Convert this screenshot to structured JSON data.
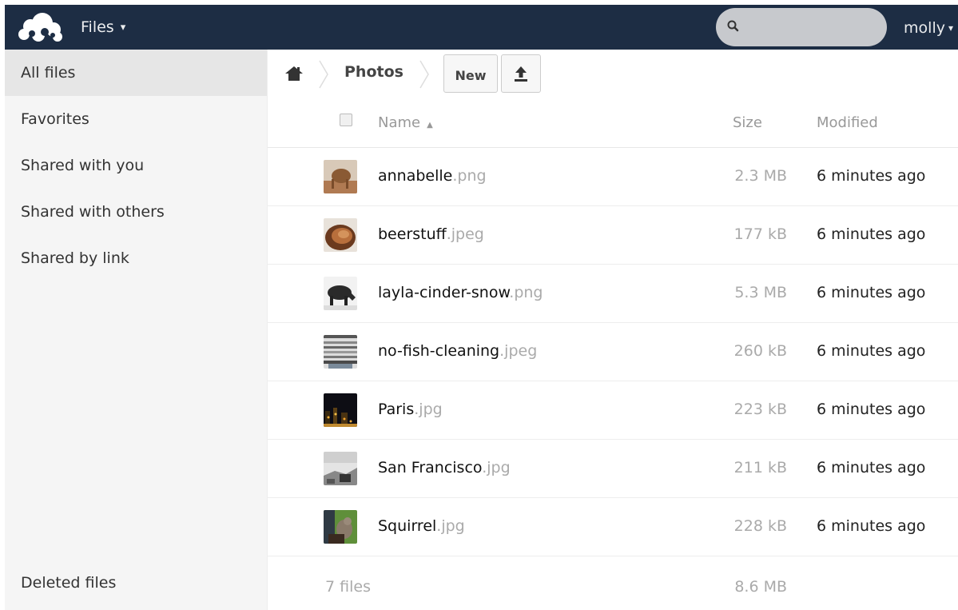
{
  "header": {
    "app_name": "Files",
    "app_caret": "▾",
    "search_placeholder": "",
    "user_name": "molly",
    "user_caret": "▾"
  },
  "sidebar": {
    "items": [
      {
        "label": "All files",
        "active": true
      },
      {
        "label": "Favorites"
      },
      {
        "label": "Shared with you"
      },
      {
        "label": "Shared with others"
      },
      {
        "label": "Shared by link"
      }
    ],
    "bottom": {
      "label": "Deleted files"
    }
  },
  "breadcrumb": {
    "current": "Photos"
  },
  "toolbar": {
    "new_label": "New",
    "upload_icon": "upload-icon"
  },
  "table": {
    "columns": {
      "name": "Name",
      "sort_indicator": "▲",
      "size": "Size",
      "modified": "Modified"
    },
    "rows": [
      {
        "name": "annabelle",
        "ext": ".png",
        "size": "2.3 MB",
        "modified": "6 minutes ago"
      },
      {
        "name": "beerstuff",
        "ext": ".jpeg",
        "size": "177 kB",
        "modified": "6 minutes ago"
      },
      {
        "name": "layla-cinder-snow",
        "ext": ".png",
        "size": "5.3 MB",
        "modified": "6 minutes ago"
      },
      {
        "name": "no-fish-cleaning",
        "ext": ".jpeg",
        "size": "260 kB",
        "modified": "6 minutes ago"
      },
      {
        "name": "Paris",
        "ext": ".jpg",
        "size": "223 kB",
        "modified": "6 minutes ago"
      },
      {
        "name": "San Francisco",
        "ext": ".jpg",
        "size": "211 kB",
        "modified": "6 minutes ago"
      },
      {
        "name": "Squirrel",
        "ext": ".jpg",
        "size": "228 kB",
        "modified": "6 minutes ago"
      }
    ],
    "summary": {
      "count": "7 files",
      "total": "8.6 MB"
    }
  },
  "colors": {
    "header_bg": "#1d2d44",
    "sidebar_bg": "#f5f5f5",
    "sidebar_active_bg": "#e6e6e6"
  }
}
